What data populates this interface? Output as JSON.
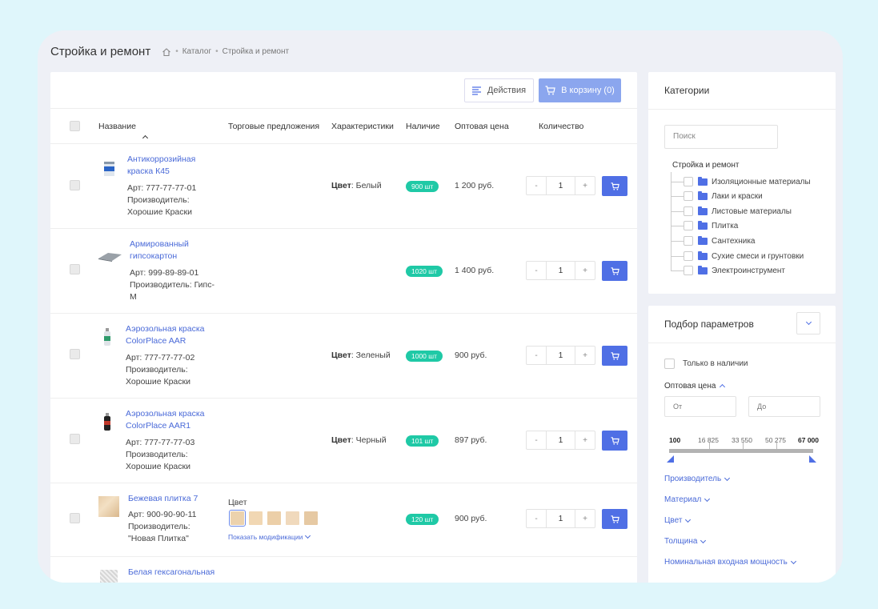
{
  "header": {
    "title": "Стройка и ремонт",
    "breadcrumbs": [
      "Каталог",
      "Стройка и ремонт"
    ]
  },
  "toolbar": {
    "actions_label": "Действия",
    "cart_label": "В корзину (0)"
  },
  "table": {
    "columns": [
      "Название",
      "Торговые предложения",
      "Характеристики",
      "Наличие",
      "Оптовая цена",
      "Количество"
    ]
  },
  "products": [
    {
      "name_lines": [
        "Антикоррозийная",
        "краска К45"
      ],
      "art": "Арт: 777-77-77-01",
      "maker_lines": [
        "Производитель:",
        "Хорошие Краски"
      ],
      "char_key": "Цвет",
      "char_val": ": Белый",
      "stock": "900 шт",
      "price": "1 200 руб.",
      "qty": "1"
    },
    {
      "name_lines": [
        "Армированный",
        "гипсокартон"
      ],
      "art": "Арт: 999-89-89-01",
      "maker_lines": [
        "Производитель: Гипс-",
        "М"
      ],
      "char_key": "",
      "char_val": "",
      "stock": "1020 шт",
      "price": "1 400 руб.",
      "qty": "1"
    },
    {
      "name_lines": [
        "Аэрозольная краска",
        "ColorPlace AAR"
      ],
      "art": "Арт: 777-77-77-02",
      "maker_lines": [
        "Производитель:",
        "Хорошие Краски"
      ],
      "char_key": "Цвет",
      "char_val": ": Зеленый",
      "stock": "1000 шт",
      "price": "900 руб.",
      "qty": "1"
    },
    {
      "name_lines": [
        "Аэрозольная краска",
        "ColorPlace AAR1"
      ],
      "art": "Арт: 777-77-77-03",
      "maker_lines": [
        "Производитель:",
        "Хорошие Краски"
      ],
      "char_key": "Цвет",
      "char_val": ": Черный",
      "stock": "101 шт",
      "price": "897 руб.",
      "qty": "1"
    },
    {
      "name_lines": [
        "Бежевая плитка 7"
      ],
      "art": "Арт: 900-90-90-11",
      "maker_lines": [
        "Производитель:",
        "\"Новая Плитка\""
      ],
      "char_key": "",
      "char_val": "",
      "stock": "120 шт",
      "price": "900 руб.",
      "qty": "1",
      "offers_label": "Цвет",
      "offers_link": "Показать модификации"
    },
    {
      "name_lines": [
        "Белая гексагональная"
      ],
      "art": "",
      "maker_lines": [],
      "char_key": "",
      "char_val": "",
      "stock": "",
      "price": "",
      "qty": ""
    }
  ],
  "qty_minus": "-",
  "qty_plus": "+",
  "categories": {
    "title": "Категории",
    "search_placeholder": "Поиск",
    "root": "Стройка и ремонт",
    "items": [
      "Изоляционные материалы",
      "Лаки и краски",
      "Листовые материалы",
      "Плитка",
      "Сантехника",
      "Сухие смеси и грунтовки",
      "Электроинструмент"
    ]
  },
  "filters": {
    "title": "Подбор параметров",
    "in_stock": "Только в наличии",
    "price_title": "Оптовая цена",
    "from_placeholder": "От",
    "to_placeholder": "До",
    "scale": [
      "100",
      "16 825",
      "33 550",
      "50 275",
      "67 000"
    ],
    "facets": [
      "Производитель",
      "Материал",
      "Цвет",
      "Толщина",
      "Номинальная входная мощность"
    ]
  },
  "colors": {
    "accent": "#4f6fe5",
    "cart_button": "#8ba6ee",
    "stock_badge": "#1fc9a6",
    "link": "#4a6ad8"
  }
}
